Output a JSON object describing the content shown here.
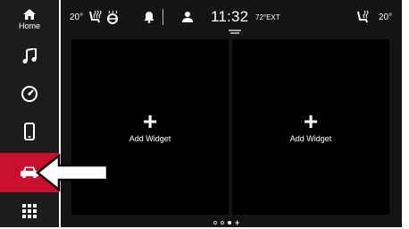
{
  "sidebar": {
    "home_label": "Home",
    "items": [
      {
        "name": "home",
        "icon": "home-icon"
      },
      {
        "name": "media",
        "icon": "music-note-icon"
      },
      {
        "name": "performance",
        "icon": "gauge-icon"
      },
      {
        "name": "phone",
        "icon": "phone-icon"
      },
      {
        "name": "vehicle",
        "icon": "car-icon",
        "active": true,
        "color": "#c8102e"
      },
      {
        "name": "apps",
        "icon": "grid-icon"
      }
    ]
  },
  "status_bar": {
    "driver_temp": "20°",
    "passenger_temp": "20°",
    "time": "11:32",
    "exterior_temp": "72°EXT",
    "icons": [
      "heated-seat-icon",
      "heated-steering-icon",
      "bell-icon",
      "user-icon",
      "seat-icon"
    ]
  },
  "widgets": [
    {
      "label": "Add Widget",
      "icon": "plus-icon"
    },
    {
      "label": "Add Widget",
      "icon": "plus-icon"
    }
  ],
  "pager": {
    "pages": 3,
    "active": 3,
    "add_icon": "plus-icon"
  },
  "colors": {
    "accent": "#c8102e",
    "background": "#111111",
    "panel": "#000000"
  }
}
